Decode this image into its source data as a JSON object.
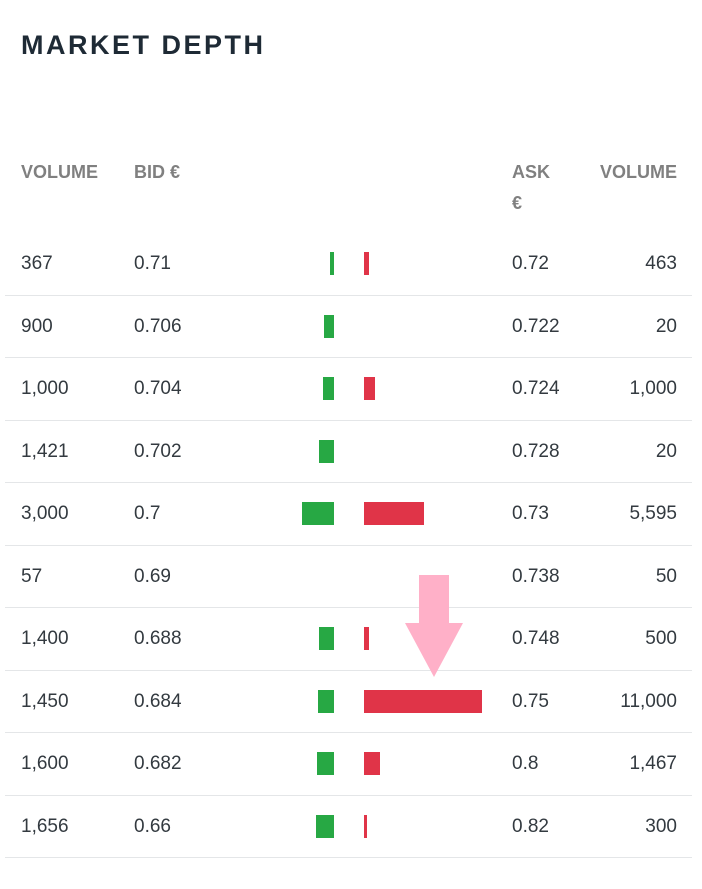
{
  "title": "MARKET DEPTH",
  "headers": {
    "volume_left": "VOLUME",
    "bid": "BID €",
    "ask": "ASK €",
    "volume_right": "VOLUME"
  },
  "colors": {
    "bid_bar": "#27a844",
    "ask_bar": "#e03448",
    "annotation_arrow": "#ffb0c8"
  },
  "max_volume": 11000,
  "rows": [
    {
      "bid_volume": "367",
      "bid": "0.71",
      "ask": "0.72",
      "ask_volume": "463",
      "bid_qty": 367,
      "ask_qty": 463
    },
    {
      "bid_volume": "900",
      "bid": "0.706",
      "ask": "0.722",
      "ask_volume": "20",
      "bid_qty": 900,
      "ask_qty": 20
    },
    {
      "bid_volume": "1,000",
      "bid": "0.704",
      "ask": "0.724",
      "ask_volume": "1,000",
      "bid_qty": 1000,
      "ask_qty": 1000
    },
    {
      "bid_volume": "1,421",
      "bid": "0.702",
      "ask": "0.728",
      "ask_volume": "20",
      "bid_qty": 1421,
      "ask_qty": 20
    },
    {
      "bid_volume": "3,000",
      "bid": "0.7",
      "ask": "0.73",
      "ask_volume": "5,595",
      "bid_qty": 3000,
      "ask_qty": 5595
    },
    {
      "bid_volume": "57",
      "bid": "0.69",
      "ask": "0.738",
      "ask_volume": "50",
      "bid_qty": 57,
      "ask_qty": 50
    },
    {
      "bid_volume": "1,400",
      "bid": "0.688",
      "ask": "0.748",
      "ask_volume": "500",
      "bid_qty": 1400,
      "ask_qty": 500
    },
    {
      "bid_volume": "1,450",
      "bid": "0.684",
      "ask": "0.75",
      "ask_volume": "11,000",
      "bid_qty": 1450,
      "ask_qty": 11000
    },
    {
      "bid_volume": "1,600",
      "bid": "0.682",
      "ask": "0.8",
      "ask_volume": "1,467",
      "bid_qty": 1600,
      "ask_qty": 1467
    },
    {
      "bid_volume": "1,656",
      "bid": "0.66",
      "ask": "0.82",
      "ask_volume": "300",
      "bid_qty": 1656,
      "ask_qty": 300
    }
  ]
}
